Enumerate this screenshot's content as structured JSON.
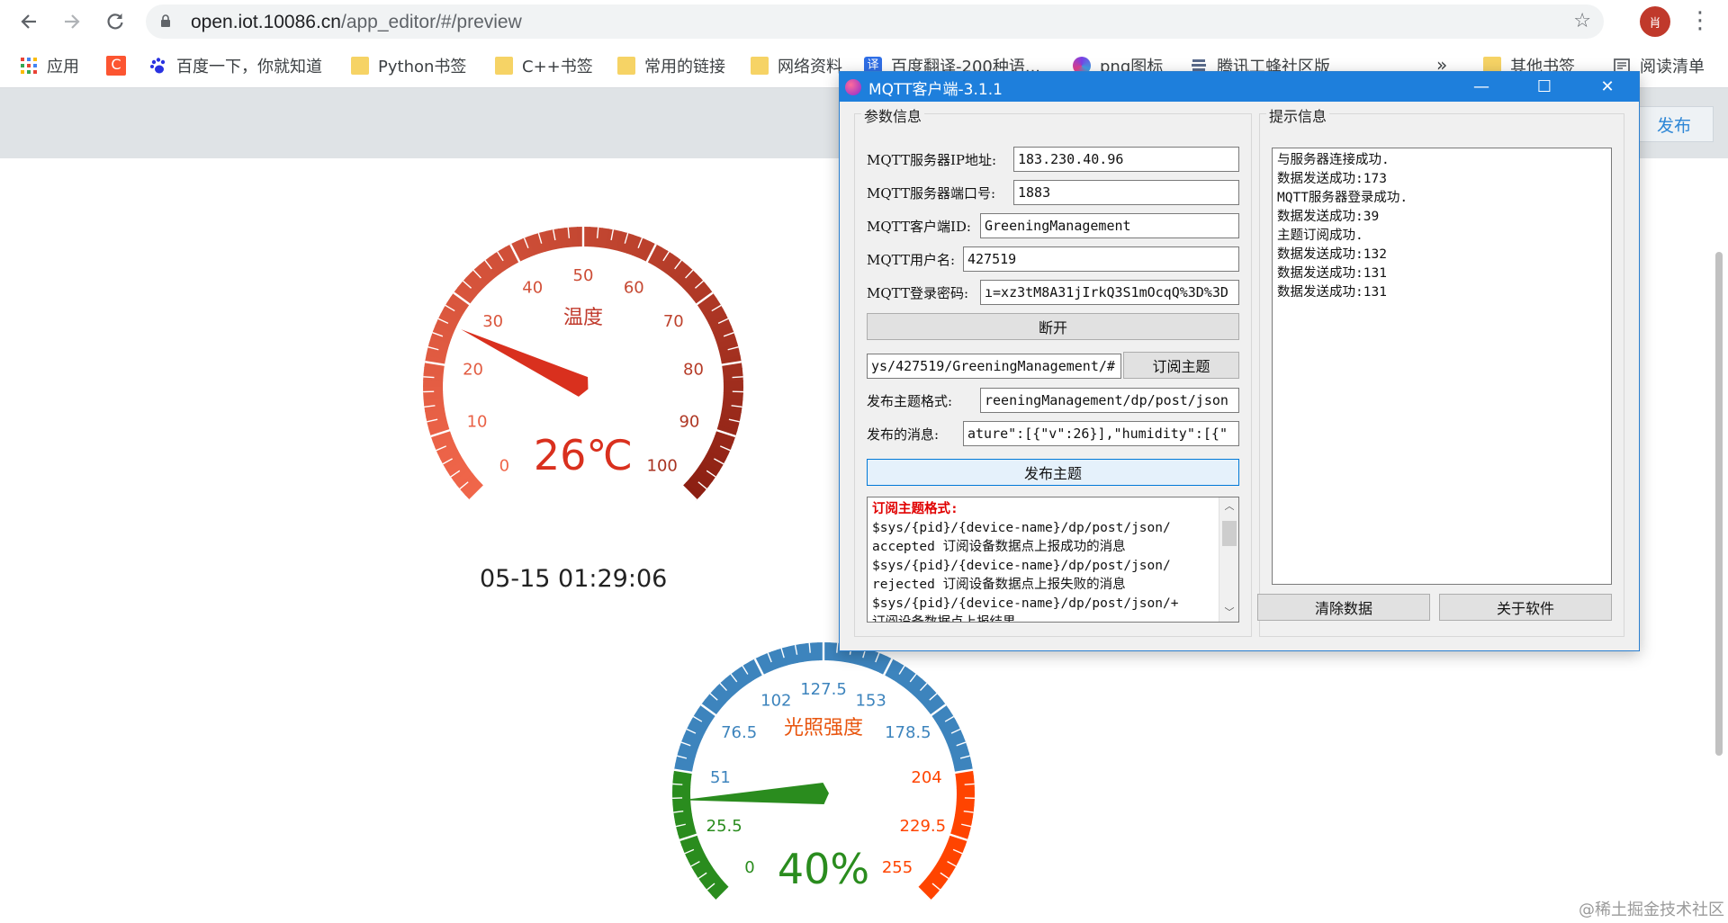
{
  "browser": {
    "url_host": "open.iot.10086.cn",
    "url_path": "/app_editor/#/preview",
    "profile_initial": "肖",
    "bookmarks": [
      {
        "label": "应用",
        "icon": "apps-grid-icon"
      },
      {
        "label": "",
        "icon": "csdn-icon"
      },
      {
        "label": "百度一下，你就知道",
        "icon": "baidu-paw-icon"
      },
      {
        "label": "Python书签",
        "icon": "folder-icon"
      },
      {
        "label": "C++书签",
        "icon": "folder-icon"
      },
      {
        "label": "常用的链接",
        "icon": "folder-icon"
      },
      {
        "label": "网络资料",
        "icon": "folder-icon"
      },
      {
        "label": "百度翻译-200种语...",
        "icon": "translate-icon"
      },
      {
        "label": "png图标",
        "icon": "pinwheel-icon"
      },
      {
        "label": "腾讯工蜂社区版",
        "icon": "bee-icon"
      },
      {
        "label": "其他书签",
        "icon": "folder-icon"
      },
      {
        "label": "阅读清单",
        "icon": "reading-list-icon"
      }
    ],
    "overflow": "»"
  },
  "page": {
    "publish_button": "发布",
    "datetime": "05-15 01:29:06",
    "watermark": "@稀土掘金技术社区"
  },
  "gauge_temperature": {
    "title": "温度",
    "value": 26,
    "value_text": "26℃",
    "min": 0,
    "max": 100,
    "ticks": [
      "0",
      "10",
      "20",
      "30",
      "40",
      "50",
      "60",
      "70",
      "80",
      "90",
      "100"
    ],
    "colors": {
      "low": "#f0664a",
      "high": "#8b1f12",
      "title": "#c0392b"
    }
  },
  "gauge_light": {
    "title": "光照强度",
    "value": 40,
    "value_text": "40%",
    "min": 0,
    "max": 255,
    "ticks": [
      "0",
      "25.5",
      "51",
      "76.5",
      "102",
      "127.5",
      "153",
      "178.5",
      "204",
      "229.5",
      "255"
    ],
    "colors": {
      "green": "#2a8c1e",
      "blue": "#3d84bd",
      "red": "#ff4400",
      "title": "#e8540d"
    }
  },
  "mqtt": {
    "window_title": "MQTT客户端-3.1.1",
    "params_group": "参数信息",
    "hint_group": "提示信息",
    "fields": {
      "ip_label": "MQTT服务器IP地址:",
      "ip_value": "183.230.40.96",
      "port_label": "MQTT服务器端口号:",
      "port_value": "1883",
      "client_label": "MQTT客户端ID:",
      "client_value": "GreeningManagement",
      "user_label": "MQTT用户名:",
      "user_value": "427519",
      "pass_label": "MQTT登录密码:",
      "pass_value": "ı=xz3tM8A31jIrkQ3S1mOcqQ%3D%3D",
      "subscribe_topic_value": "ys/427519/GreeningManagement/#",
      "publish_format_label": "发布主题格式:",
      "publish_format_value": "reeningManagement/dp/post/json",
      "publish_msg_label": "发布的消息:",
      "publish_msg_value": "ature\":[{\"v\":26}],\"humidity\":[{\""
    },
    "buttons": {
      "disconnect": "断开",
      "subscribe": "订阅主题",
      "publish": "发布主题",
      "clear": "清除数据",
      "about": "关于软件"
    },
    "help_text": {
      "heading": "订阅主题格式:",
      "lines": [
        "$sys/{pid}/{device-name}/dp/post/json/",
        "accepted 订阅设备数据点上报成功的消息",
        "$sys/{pid}/{device-name}/dp/post/json/",
        "rejected 订阅设备数据点上报失败的消息",
        "$sys/{pid}/{device-name}/dp/post/json/+",
        "订阅设备数据点上报结果"
      ]
    },
    "log": [
      "与服务器连接成功.",
      "数据发送成功:173",
      "MQTT服务器登录成功.",
      "数据发送成功:39",
      "主题订阅成功.",
      "数据发送成功:132",
      "数据发送成功:131",
      "数据发送成功:131"
    ]
  }
}
